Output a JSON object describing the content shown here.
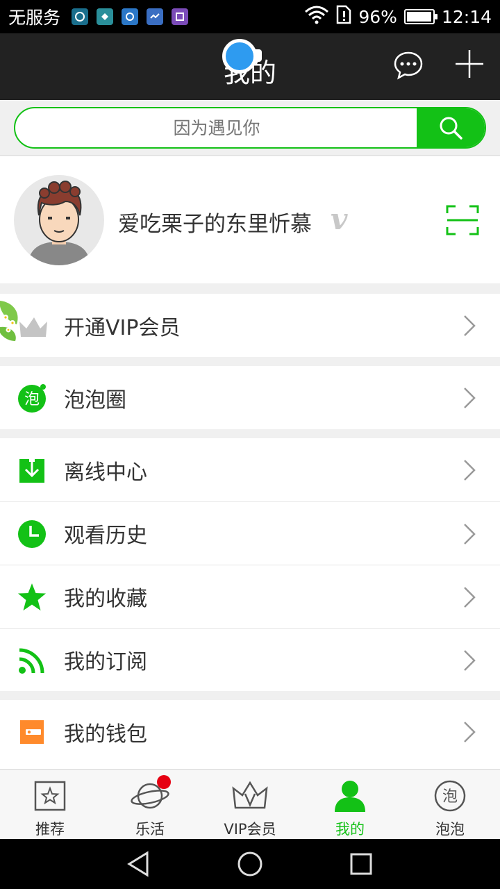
{
  "status_bar": {
    "carrier": "无服务",
    "battery": "96%",
    "battery_level": 0.96,
    "time": "12:14"
  },
  "header": {
    "title": "我的",
    "icons": [
      "chat-bubble-icon",
      "plus-icon"
    ]
  },
  "search": {
    "placeholder": "因为遇见你",
    "button_icon": "search-icon"
  },
  "profile": {
    "username": "爱吃栗子的东里忻慕",
    "badge": "v",
    "scan_icon": "scan-icon"
  },
  "menu": {
    "vip": {
      "label": "开通VIP会员",
      "icon": "crown-icon"
    },
    "bubble_circle": {
      "label": "泡泡圈",
      "icon": "bubble-icon",
      "icon_text": "泡"
    },
    "offline": {
      "label": "离线中心",
      "icon": "download-icon"
    },
    "history": {
      "label": "观看历史",
      "icon": "clock-icon"
    },
    "favorites": {
      "label": "我的收藏",
      "icon": "star-icon"
    },
    "subscriptions": {
      "label": "我的订阅",
      "icon": "rss-icon"
    },
    "wallet": {
      "label": "我的钱包",
      "icon": "wallet-icon"
    }
  },
  "tabs": [
    {
      "label": "推荐",
      "icon": "star-box-icon"
    },
    {
      "label": "乐活",
      "icon": "planet-icon"
    },
    {
      "label": "VIP会员",
      "icon": "crown-icon"
    },
    {
      "label": "我的",
      "icon": "person-icon",
      "active": true
    },
    {
      "label": "泡泡",
      "icon": "bubble-icon",
      "icon_text": "泡"
    }
  ],
  "colors": {
    "accent": "#13c116",
    "header_bg": "#222222",
    "wallet_orange": "#ff8a2b",
    "notification_red": "#e60012"
  }
}
